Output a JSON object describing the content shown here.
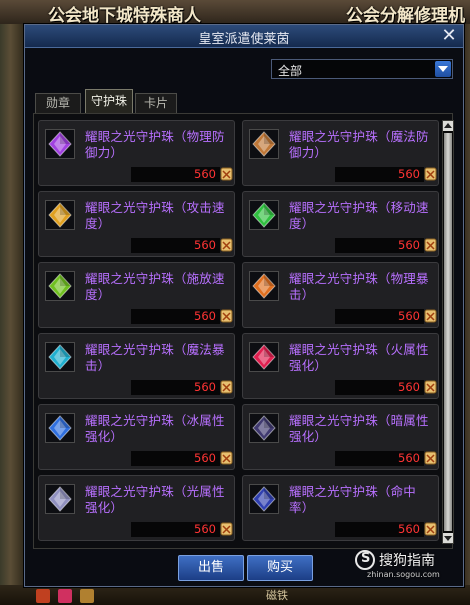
{
  "background": {
    "top_left_text": "公会地下城特殊商人",
    "top_right_text": "公会分解修理机",
    "bottom_label": "磁铁"
  },
  "dialog": {
    "title": "皇室派遣使莱茵",
    "close_glyph": "✕",
    "filter": {
      "selected": "全部"
    },
    "tabs": [
      {
        "label": "勋章",
        "active": false
      },
      {
        "label": "守护珠",
        "active": true
      },
      {
        "label": "卡片",
        "active": false
      }
    ],
    "items": [
      {
        "name": "耀眼之光守护珠（物理防御力）",
        "price": "560",
        "gem_color": "#a040e0"
      },
      {
        "name": "耀眼之光守护珠（魔法防御力）",
        "price": "560",
        "gem_color": "#c07838"
      },
      {
        "name": "耀眼之光守护珠（攻击速度）",
        "price": "560",
        "gem_color": "#e0a020"
      },
      {
        "name": "耀眼之光守护珠（移动速度）",
        "price": "560",
        "gem_color": "#30c040"
      },
      {
        "name": "耀眼之光守护珠（施放速度）",
        "price": "560",
        "gem_color": "#70c020"
      },
      {
        "name": "耀眼之光守护珠（物理暴击）",
        "price": "560",
        "gem_color": "#e07020"
      },
      {
        "name": "耀眼之光守护珠（魔法暴击）",
        "price": "560",
        "gem_color": "#20b0d0"
      },
      {
        "name": "耀眼之光守护珠（火属性强化）",
        "price": "560",
        "gem_color": "#e02050"
      },
      {
        "name": "耀眼之光守护珠（冰属性强化）",
        "price": "560",
        "gem_color": "#3070e0"
      },
      {
        "name": "耀眼之光守护珠（暗属性强化）",
        "price": "560",
        "gem_color": "#403a70"
      },
      {
        "name": "耀眼之光守护珠（光属性强化）",
        "price": "560",
        "gem_color": "#9090c0"
      },
      {
        "name": "耀眼之光守护珠（命中率）",
        "price": "560",
        "gem_color": "#3040b0"
      }
    ],
    "buttons": {
      "sell": "出售",
      "buy": "购买"
    }
  },
  "watermark": {
    "text": "搜狗指南",
    "url": "zhinan.sogou.com"
  },
  "icons": {
    "close": "close-icon",
    "dropdown": "chevron-down-icon",
    "gem": "gem-icon",
    "coin": "coin-icon"
  }
}
